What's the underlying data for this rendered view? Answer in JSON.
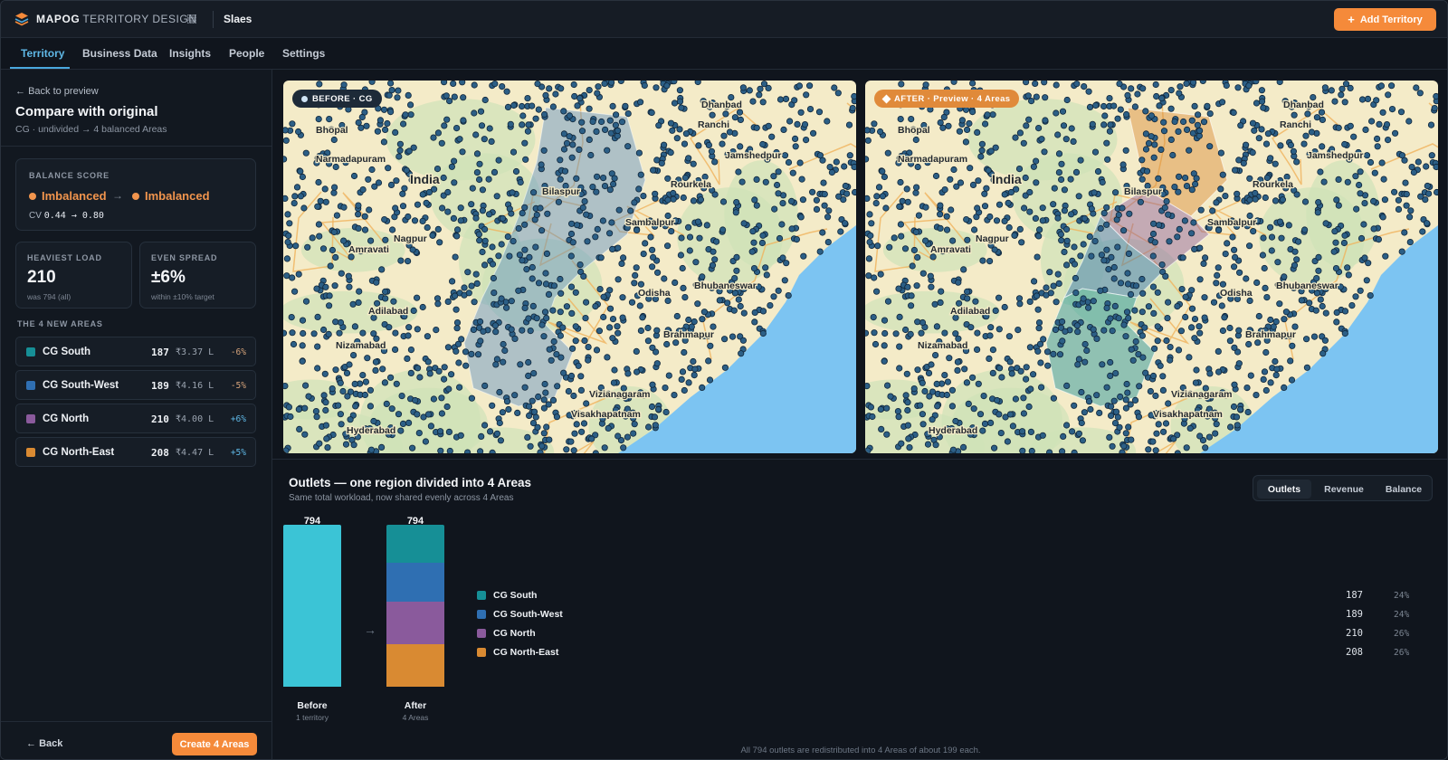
{
  "header": {
    "brand": "MAPOG",
    "brand_sub": "TERRITORY DESIGN",
    "workspace": "Slaes",
    "add_button": "Add Territory"
  },
  "tabs": [
    {
      "label": "Territory",
      "active": true
    },
    {
      "label": "Business Data"
    },
    {
      "label": "Insights"
    },
    {
      "label": "People"
    },
    {
      "label": "Settings"
    }
  ],
  "sidebar": {
    "back_link": "Back to preview",
    "title": "Compare with original",
    "subtitle": "CG · undivided → 4 balanced Areas",
    "balance": {
      "label": "BALANCE SCORE",
      "before": "Imbalanced",
      "after": "Imbalanced",
      "cv_label": "CV",
      "cv_value": "0.44 → 0.80"
    },
    "heaviest": {
      "label": "HEAVIEST LOAD",
      "value": "210",
      "note": "was 794 (all)"
    },
    "spread": {
      "label": "EVEN SPREAD",
      "value": "±6%",
      "note": "within ±10% target"
    },
    "areas_label": "THE 4 NEW AREAS",
    "areas": [
      {
        "name": "CG South",
        "count": "187",
        "revenue": "₹3.37 L",
        "delta": "-6%",
        "color": "#168f96"
      },
      {
        "name": "CG South-West",
        "count": "189",
        "revenue": "₹4.16 L",
        "delta": "-5%",
        "color": "#2f6fb2"
      },
      {
        "name": "CG North",
        "count": "210",
        "revenue": "₹4.00 L",
        "delta": "+6%",
        "color": "#8a5a9c"
      },
      {
        "name": "CG North-East",
        "count": "208",
        "revenue": "₹4.47 L",
        "delta": "+5%",
        "color": "#d98a32"
      }
    ],
    "back_button": "Back",
    "create_button": "Create 4 Areas"
  },
  "maps": {
    "before_badge": "BEFORE · CG",
    "after_badge": "AFTER · Preview · 4 Areas",
    "labels": [
      "Bhopal",
      "Narmadapuram",
      "India",
      "Nagpur",
      "Ranchi",
      "Jamshedpur",
      "Sambalpur",
      "Bhubaneswar",
      "Rourkela",
      "Odisha",
      "Brahmapur",
      "Vizianagaram",
      "Visakhapatnam",
      "Adilabad",
      "Nizamabad",
      "Amravati",
      "Bilaspur",
      "Dhanbad",
      "Hyderabad"
    ]
  },
  "panel": {
    "title": "Outlets — one region divided into 4 Areas",
    "subtitle": "Same total workload, now shared evenly across 4 Areas",
    "segments": [
      "Outlets",
      "Revenue",
      "Balance"
    ],
    "active_segment": "Outlets",
    "footnote": "All 794 outlets are redistributed into 4 Areas of about 199 each."
  },
  "chart_data": {
    "type": "bar",
    "categories": [
      "Before",
      "After"
    ],
    "category_notes": [
      "1 territory",
      "4 Areas"
    ],
    "totals": [
      794,
      794
    ],
    "before_color": "#3bc4d6",
    "series": [
      {
        "name": "CG South",
        "values": [
          0,
          187
        ],
        "share": "24%",
        "color": "#168f96"
      },
      {
        "name": "CG South-West",
        "values": [
          0,
          189
        ],
        "share": "24%",
        "color": "#2f6fb2"
      },
      {
        "name": "CG North",
        "values": [
          0,
          210
        ],
        "share": "26%",
        "color": "#8a5a9c"
      },
      {
        "name": "CG North-East",
        "values": [
          0,
          208
        ],
        "share": "26%",
        "color": "#d98a32"
      }
    ],
    "ylim": [
      0,
      794
    ]
  }
}
